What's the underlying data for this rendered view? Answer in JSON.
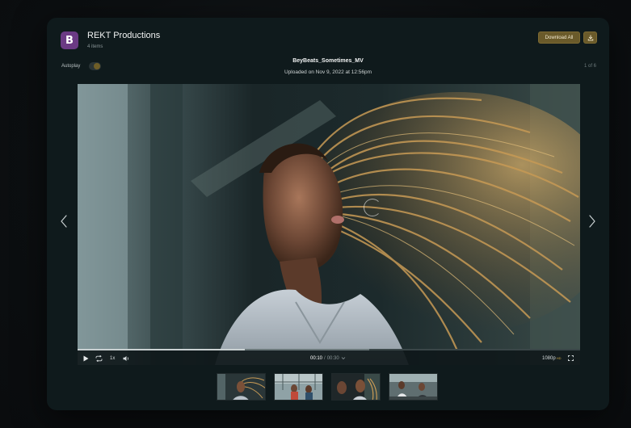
{
  "header": {
    "brand_name": "REKT Productions",
    "brand_initial": "B",
    "item_count": "4 items",
    "download_all_label": "Download All",
    "download_icon": "download-icon"
  },
  "autoplay": {
    "label": "Autoplay",
    "enabled": false
  },
  "file": {
    "title": "BeyBeats_Sometimes_MV",
    "uploaded": "Uploaded on Nov 9, 2022 at 12:56pm",
    "pager": "1 of 6"
  },
  "player": {
    "speed": "1x",
    "current_time": "00:10",
    "separator": "/",
    "total_time": "00:30",
    "quality": "1080p",
    "quality_badge": "HD",
    "progress_fraction": 0.333,
    "buffer_fraction": 0.58,
    "icons": {
      "play": "play-icon",
      "loop": "loop-icon",
      "volume": "volume-icon",
      "fullscreen": "fullscreen-icon",
      "prev": "chevron-left-icon",
      "next": "chevron-right-icon"
    }
  },
  "thumbnails": [
    {
      "label": "thumb-1"
    },
    {
      "label": "thumb-2"
    },
    {
      "label": "thumb-3"
    },
    {
      "label": "thumb-4"
    }
  ],
  "colors": {
    "panel_bg": "#0f1a1c",
    "accent_gold": "#6a5a2a",
    "logo_purple": "#6b3a84"
  }
}
